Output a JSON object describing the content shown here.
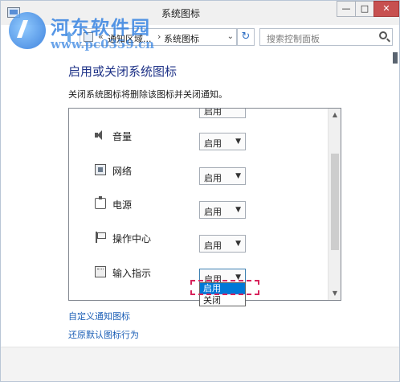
{
  "window": {
    "title": "系统图标",
    "minimize_glyph": "—",
    "maximize_glyph": "□",
    "close_glyph": "✕"
  },
  "watermark": {
    "title": "河东软件园",
    "url": "www.pc0359.cn"
  },
  "navbar": {
    "breadcrumb_chevron": "«",
    "breadcrumb_parent": "通知区域...",
    "breadcrumb_separator": "›",
    "breadcrumb_current": "系统图标",
    "dropdown_glyph": "⌄",
    "refresh_glyph": "↻",
    "search_placeholder": "搜索控制面板"
  },
  "content": {
    "heading": "启用或关闭系统图标",
    "description": "关闭系统图标将删除该图标并关闭通知。",
    "partial_row_value": "启用",
    "rows": [
      {
        "label": "音量",
        "value": "启用",
        "icon": "speaker-icon"
      },
      {
        "label": "网络",
        "value": "启用",
        "icon": "network-icon"
      },
      {
        "label": "电源",
        "value": "启用",
        "icon": "power-icon"
      },
      {
        "label": "操作中心",
        "value": "启用",
        "icon": "flag-icon"
      },
      {
        "label": "输入指示",
        "value": "启用",
        "icon": "keyboard-icon"
      }
    ],
    "dropdown_options": [
      "启用",
      "关闭"
    ],
    "dropdown_selected_index": 0,
    "links": {
      "customize": "自定义通知图标",
      "restore": "还原默认图标行为"
    }
  },
  "colors": {
    "heading": "#1e3287",
    "link": "#1c5fb6",
    "selection": "#0078d7",
    "close_button": "#c75050",
    "highlight": "#d8245c",
    "watermark": "#2b7de0"
  }
}
